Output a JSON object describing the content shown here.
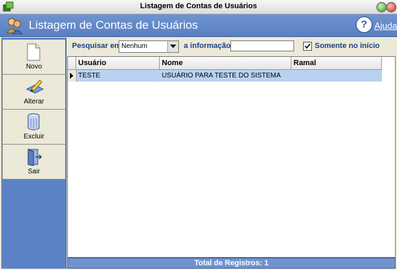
{
  "window": {
    "title": "Listagem de Contas de Usuários"
  },
  "header": {
    "title": "Listagem de Contas de Usuários",
    "help_label": "Ajuda"
  },
  "sidebar": {
    "items": [
      {
        "label": "Novo",
        "icon": "new-document-icon"
      },
      {
        "label": "Alterar",
        "icon": "edit-icon"
      },
      {
        "label": "Excluir",
        "icon": "trash-icon"
      },
      {
        "label": "Sair",
        "icon": "exit-door-icon"
      }
    ]
  },
  "filter": {
    "search_in_label": "Pesquisar em",
    "search_in_value": "Nenhum",
    "info_label": "a informação",
    "info_value": "",
    "only_start_label": "Somente no início",
    "only_start_checked": true
  },
  "grid": {
    "columns": [
      "Usuário",
      "Nome",
      "Ramal"
    ],
    "rows": [
      {
        "usuario": "TESTE",
        "nome": "USUÁRIO PARA TESTE DO SISTEMA",
        "ramal": ""
      }
    ]
  },
  "footer": {
    "total_label": "Total de Registros: 1"
  }
}
